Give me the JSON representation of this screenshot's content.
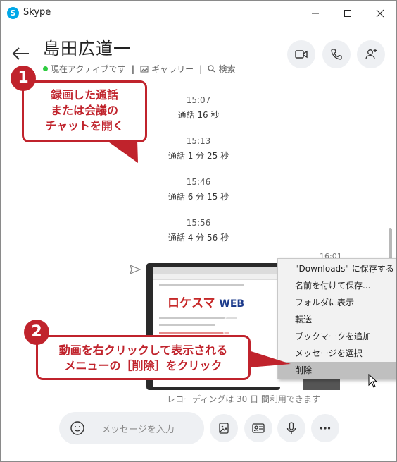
{
  "window": {
    "title": "Skype",
    "app_icon_letter": "S"
  },
  "header": {
    "contact_name": "島田広道一",
    "status": "現在アクティブです",
    "gallery_label": "ギャラリー",
    "search_label": "検索"
  },
  "messages": [
    {
      "time": "15:07",
      "call": "通話 16 秒"
    },
    {
      "time": "15:13",
      "call": "通話 1 分 25 秒"
    },
    {
      "time": "15:46",
      "call": "通話 6 分 15 秒"
    },
    {
      "time": "15:56",
      "call": "通話 4 分 56 秒"
    }
  ],
  "video_message": {
    "time": "16:01",
    "logo_text": "ロケスマ",
    "logo_suffix": "WEB",
    "recording_note": "レコーディングは 30 日 間利用できます"
  },
  "context_menu": {
    "items": [
      "\"Downloads\" に保存する",
      "名前を付けて保存...",
      "フォルダに表示",
      "転送",
      "ブックマークを追加",
      "メッセージを選択",
      "削除"
    ],
    "highlighted_index": 6
  },
  "callouts": {
    "step1_number": "1",
    "step1_text_line1": "録画した通話",
    "step1_text_line2": "または会議の",
    "step1_text_line3": "チャットを開く",
    "step2_number": "2",
    "step2_text_line1": "動画を右クリックして表示される",
    "step2_text_line2": "メニューの［削除］をクリック"
  },
  "composer": {
    "placeholder": "メッセージを入力"
  },
  "colors": {
    "accent_red": "#c0232c",
    "skype_blue": "#00a8e8",
    "active_green": "#2ecc40"
  }
}
